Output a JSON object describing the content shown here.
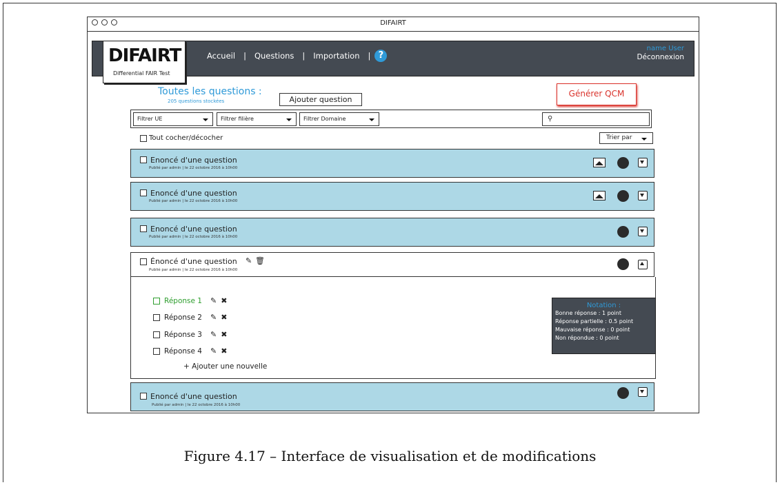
{
  "window": {
    "title": "DIFAIRT"
  },
  "header": {
    "logo_text": "DIFAIRT",
    "logo_subtitle": "Differential FAIR Test",
    "nav": [
      "Accueil",
      "Questions",
      "Importation"
    ],
    "nav_separator": "|",
    "help_glyph": "?",
    "user_name": "name User",
    "logout_label": "Déconnexion"
  },
  "toolbar": {
    "title": "Toutes les questions :",
    "subtitle": "205 questions stockées",
    "add_label": "Ajouter question",
    "generate_label": "Générer QCM"
  },
  "filters": {
    "ue": "Filtrer UE",
    "filiere": "Filtrer filière",
    "domaine": "Filtrer Domaine",
    "search_glyph": "⚲"
  },
  "check_all_label": "Tout cocher/décocher",
  "sort_label": "Trier par",
  "questions": [
    {
      "text": "Enoncé d'une question",
      "meta": "Publié par admin   |   le 22 octobre 2016 à 10h00"
    },
    {
      "text": "Enoncé d'une question",
      "meta": "Publié par admin   |   le 22 octobre 2016 à 10h00"
    },
    {
      "text": "Enoncé d'une question",
      "meta": "Publié par admin   |   le 22 octobre 2016 à 10h00"
    },
    {
      "text": "Énoncé d'une question",
      "meta": "Publié par admin   |   le 22 octobre 2016 à 10h00"
    },
    {
      "text": "Enoncé d'une question",
      "meta": "Publié par admin   |   le 22 octobre 2016 à 10h00"
    }
  ],
  "answers": [
    "Réponse 1",
    "Réponse 2",
    "Réponse 3",
    "Réponse 4"
  ],
  "add_answer_label": "+ Ajouter une nouvelle",
  "notation": {
    "title": "Notation :",
    "lines": [
      "Bonne réponse : 1 point",
      "Réponse partielle : 0.5 point",
      "Mauvaise réponse : 0 point",
      "Non répondue : 0 point"
    ]
  },
  "icons": {
    "edit": "✎",
    "delete": "✖",
    "trash": "🗑"
  },
  "colors": {
    "header": "#444a52",
    "accent": "#2f9ad8",
    "row": "#add8e6",
    "danger": "#d9322b",
    "correct": "#2e9e2e"
  },
  "caption": "Figure 4.17 – Interface de visualisation et de modifications"
}
